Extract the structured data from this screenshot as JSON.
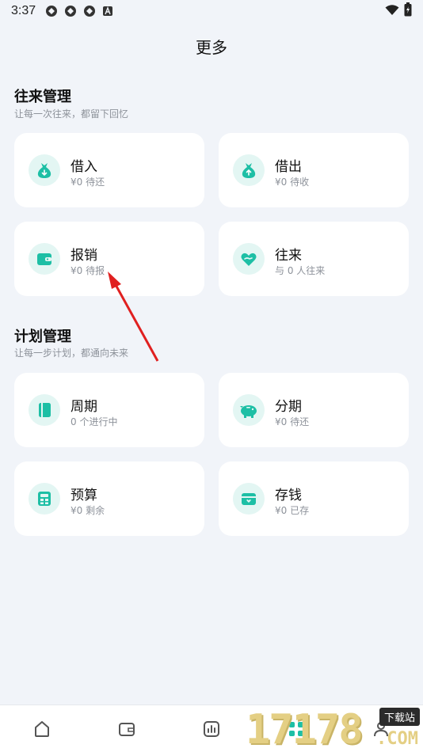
{
  "status_bar": {
    "time": "3:37"
  },
  "page_title": "更多",
  "sections": [
    {
      "title": "往来管理",
      "subtitle": "让每一次往来，都留下回忆"
    },
    {
      "title": "计划管理",
      "subtitle": "让每一步计划，都通向未来"
    }
  ],
  "cards": {
    "borrow_in": {
      "label": "借入",
      "sub": "¥0 待还",
      "icon": "money-bag-down-icon"
    },
    "lend_out": {
      "label": "借出",
      "sub": "¥0 待收",
      "icon": "money-bag-up-icon"
    },
    "reimburse": {
      "label": "报销",
      "sub": "¥0 待报",
      "icon": "wallet-icon"
    },
    "exchange": {
      "label": "往来",
      "sub": "与 0 人往来",
      "icon": "heart-hand-icon"
    },
    "cycle": {
      "label": "周期",
      "sub": "0 个进行中",
      "icon": "notebook-icon"
    },
    "installment": {
      "label": "分期",
      "sub": "¥0 待还",
      "icon": "piggy-bank-icon"
    },
    "budget": {
      "label": "预算",
      "sub": "¥0 剩余",
      "icon": "calculator-icon"
    },
    "saving": {
      "label": "存钱",
      "sub": "¥0 已存",
      "icon": "savings-box-icon"
    }
  },
  "bottom_nav": [
    "home-icon",
    "wallet-icon",
    "chart-icon",
    "more-grid-icon",
    "profile-icon"
  ],
  "watermark": {
    "digits": "17178",
    "badge": "下载站",
    "suffix": ".COM"
  },
  "colors": {
    "accent": "#1dbfa5",
    "icon_bg": "#e3f6f3",
    "background": "#f1f4f9",
    "annotation_arrow": "#e02020"
  }
}
